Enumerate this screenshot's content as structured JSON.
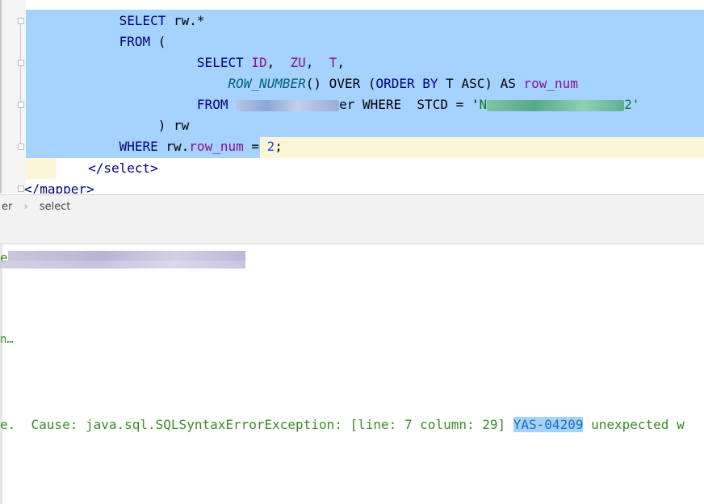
{
  "editor": {
    "line0": {
      "partial": "g"
    },
    "line1": {
      "indent": "            ",
      "select": "SELECT",
      "rest": " rw.*"
    },
    "line2": {
      "indent": "            ",
      "from": "FROM",
      "rest": " ("
    },
    "line3": {
      "indent": "                      ",
      "select": "SELECT",
      "id": "ID",
      "sep1": ",  ",
      "zu": "ZU",
      "sep2": ",  ",
      "t": "T",
      "end": ","
    },
    "line4": {
      "indent": "                          ",
      "fn": "ROW_NUMBER",
      "p1": "()",
      "over": " OVER (",
      "orderby": "ORDER BY",
      "tasc": " T ASC)",
      "as": " AS ",
      "alias": "row_num"
    },
    "line5": {
      "indent": "                      ",
      "from": "FROM",
      "tail": "er WHERE  STCD = '",
      "strpre": "N",
      "strend": "2'"
    },
    "line6": {
      "indent": "                 ",
      "text": ") rw"
    },
    "line7": {
      "indent": "            ",
      "where": "WHERE",
      "rw": " rw.",
      "col": "row_num",
      "eq": " = ",
      "num": "2",
      "semi": ";"
    },
    "line8": {
      "indent": "        ",
      "tag": "</select>"
    },
    "line9": {
      "tag": "</mapper>"
    }
  },
  "breadcrumb": {
    "part1": "er",
    "sep": "›",
    "part2": "select"
  },
  "console": {
    "line1": "e",
    "line2": "n…",
    "error_prefix": "e.  Cause: java.sql.SQLSyntaxErrorException: [line: 7 column: 29] ",
    "error_code": "YAS-04209",
    "error_suffix": " unexpected w"
  }
}
